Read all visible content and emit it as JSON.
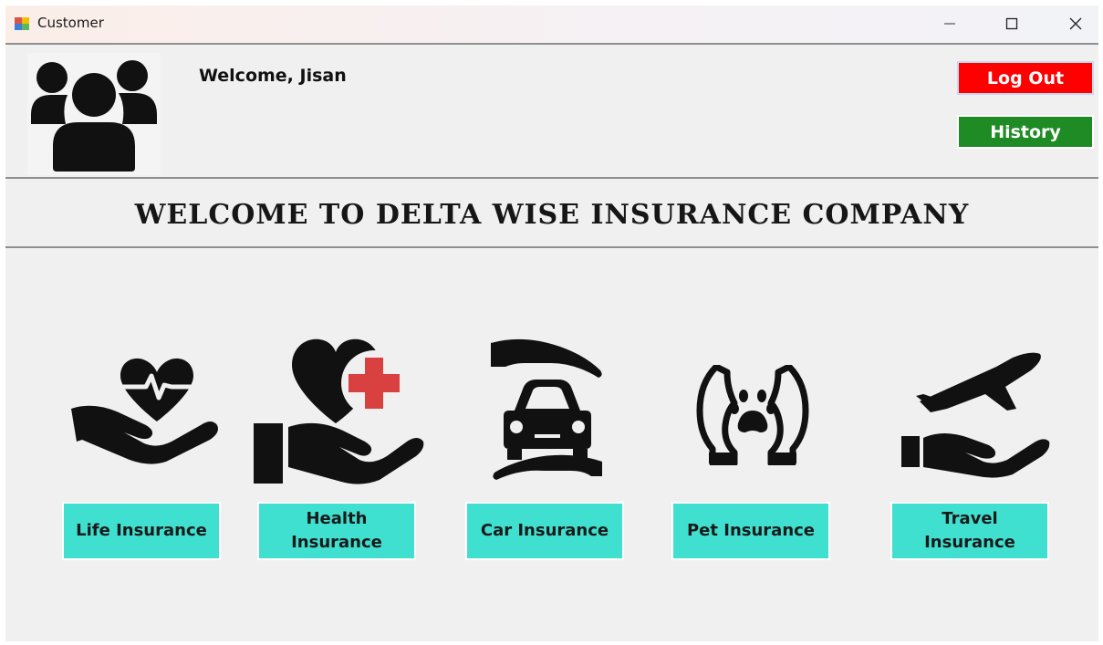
{
  "window": {
    "title": "Customer",
    "app_icon": "winforms-app-icon",
    "controls": {
      "minimize": "minimize-icon",
      "maximize": "maximize-icon",
      "close": "close-icon"
    }
  },
  "header": {
    "avatar_icon": "users-group-icon",
    "welcome_text": "Welcome, Jisan",
    "logout_label": "Log Out",
    "history_label": "History",
    "logout_color": "#ff0000",
    "history_color": "#1f8b24"
  },
  "banner": {
    "title": "WELCOME TO DELTA WISE INSURANCE COMPANY"
  },
  "insurances": [
    {
      "label": "Life Insurance",
      "icon": "heart-pulse-hand-icon"
    },
    {
      "label": "Health\nInsurance",
      "icon": "heart-plus-hand-icon"
    },
    {
      "label": "Car Insurance",
      "icon": "car-hands-icon"
    },
    {
      "label": "Pet Insurance",
      "icon": "paw-hands-icon"
    },
    {
      "label": "Travel\nInsurance",
      "icon": "plane-hand-icon"
    }
  ],
  "colors": {
    "insurance_button": "#40e0d0",
    "health_cross": "#d94040"
  }
}
